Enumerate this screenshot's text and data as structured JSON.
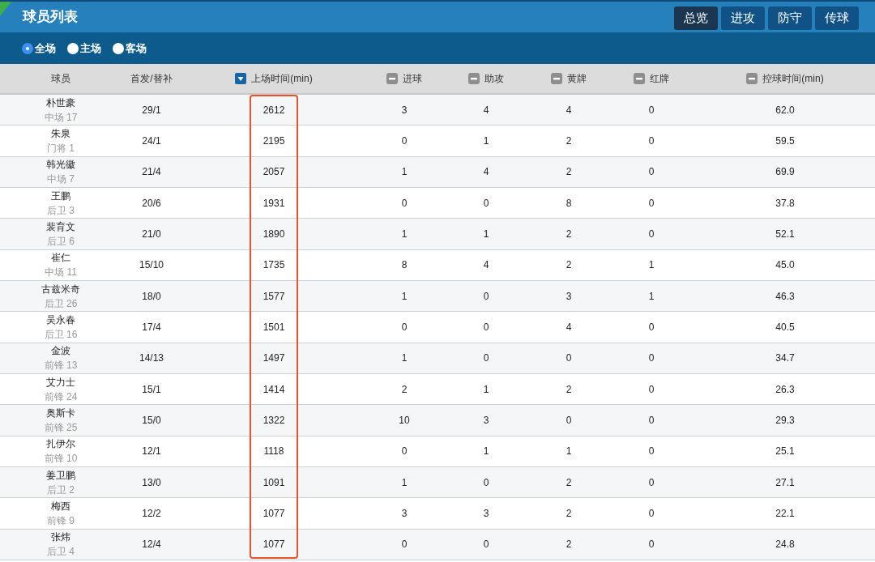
{
  "window": {
    "title": "球员列表"
  },
  "tabs": [
    {
      "label": "总览",
      "selected": true
    },
    {
      "label": "进攻",
      "selected": false
    },
    {
      "label": "防守",
      "selected": false
    },
    {
      "label": "传球",
      "selected": false
    }
  ],
  "venue_filter": [
    {
      "label": "全场",
      "selected": true
    },
    {
      "label": "主场",
      "selected": false
    },
    {
      "label": "客场",
      "selected": false
    }
  ],
  "table": {
    "columns": [
      {
        "label": "球员",
        "kind": "plain"
      },
      {
        "label": "首发/替补",
        "kind": "plain"
      },
      {
        "label": "上场时间(min)",
        "kind": "sorted",
        "highlighted": true
      },
      {
        "label": "进球",
        "kind": "sortable"
      },
      {
        "label": "助攻",
        "kind": "sortable"
      },
      {
        "label": "黄牌",
        "kind": "sortable"
      },
      {
        "label": "红牌",
        "kind": "sortable"
      },
      {
        "label": "控球时间(min)",
        "kind": "sortable"
      }
    ],
    "rows": [
      {
        "cells": [
          {
            "name": "朴世豪",
            "position": "中场 17"
          },
          "29/1",
          "2612",
          "3",
          "4",
          "4",
          "0",
          "62.0"
        ]
      },
      {
        "cells": [
          {
            "name": "朱泉",
            "position": "门将 1"
          },
          "24/1",
          "2195",
          "0",
          "1",
          "2",
          "0",
          "59.5"
        ]
      },
      {
        "cells": [
          {
            "name": "韩光徽",
            "position": "中场 7"
          },
          "21/4",
          "2057",
          "1",
          "4",
          "2",
          "0",
          "69.9"
        ]
      },
      {
        "cells": [
          {
            "name": "王鹏",
            "position": "后卫 3"
          },
          "20/6",
          "1931",
          "0",
          "0",
          "8",
          "0",
          "37.8"
        ]
      },
      {
        "cells": [
          {
            "name": "裴育文",
            "position": "后卫 6"
          },
          "21/0",
          "1890",
          "1",
          "1",
          "2",
          "0",
          "52.1"
        ]
      },
      {
        "cells": [
          {
            "name": "崔仁",
            "position": "中场 11"
          },
          "15/10",
          "1735",
          "8",
          "4",
          "2",
          "1",
          "45.0"
        ]
      },
      {
        "cells": [
          {
            "name": "古兹米奇",
            "position": "后卫 26"
          },
          "18/0",
          "1577",
          "1",
          "0",
          "3",
          "1",
          "46.3"
        ]
      },
      {
        "cells": [
          {
            "name": "吴永春",
            "position": "后卫 16"
          },
          "17/4",
          "1501",
          "0",
          "0",
          "4",
          "0",
          "40.5"
        ]
      },
      {
        "cells": [
          {
            "name": "金波",
            "position": "前锋 13"
          },
          "14/13",
          "1497",
          "1",
          "0",
          "0",
          "0",
          "34.7"
        ]
      },
      {
        "cells": [
          {
            "name": "艾力士",
            "position": "前锋 24"
          },
          "15/1",
          "1414",
          "2",
          "1",
          "2",
          "0",
          "26.3"
        ]
      },
      {
        "cells": [
          {
            "name": "奥斯卡",
            "position": "前锋 25"
          },
          "15/0",
          "1322",
          "10",
          "3",
          "0",
          "0",
          "29.3"
        ]
      },
      {
        "cells": [
          {
            "name": "扎伊尔",
            "position": "前锋 10"
          },
          "12/1",
          "1118",
          "0",
          "1",
          "1",
          "0",
          "25.1"
        ]
      },
      {
        "cells": [
          {
            "name": "姜卫鹏",
            "position": "后卫 2"
          },
          "13/0",
          "1091",
          "1",
          "0",
          "2",
          "0",
          "27.1"
        ]
      },
      {
        "cells": [
          {
            "name": "梅西",
            "position": "前锋 9"
          },
          "12/2",
          "1077",
          "3",
          "3",
          "2",
          "0",
          "22.1"
        ]
      },
      {
        "cells": [
          {
            "name": "张炜",
            "position": "后卫 4"
          },
          "12/4",
          "1077",
          "0",
          "0",
          "2",
          "0",
          "24.8"
        ]
      }
    ]
  }
}
